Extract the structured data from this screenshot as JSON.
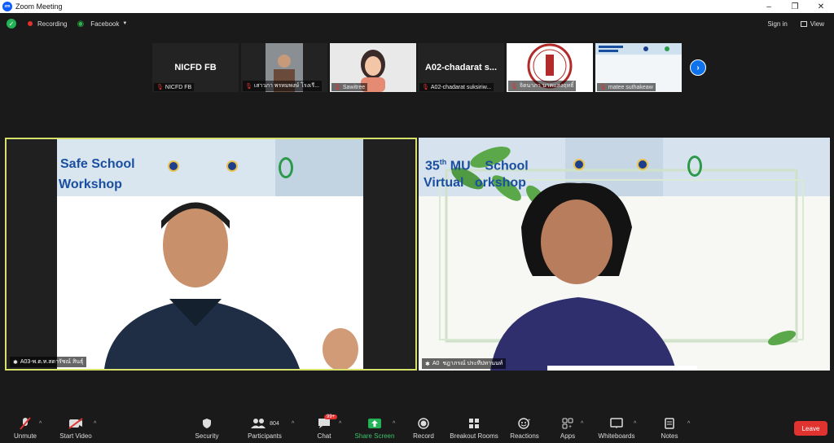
{
  "window": {
    "title": "Zoom Meeting",
    "app_logo": "zoom"
  },
  "topbar": {
    "recording_label": "Recording",
    "stream_label": "Facebook",
    "signin_label": "Sign in",
    "view_label": "View"
  },
  "thumbnails": [
    {
      "big_name": "NICFD FB",
      "caption": "NICFD FB"
    },
    {
      "big_name": "",
      "caption": "เสาวภา พรหมพงษ์ โรงเรี..."
    },
    {
      "big_name": "",
      "caption": "Sawitree"
    },
    {
      "big_name": "A02-chadarat s...",
      "caption": "A02-chadarat suksiriw..."
    },
    {
      "big_name": "",
      "caption": "จิตนาภา นาคแสงฤทธิ์"
    },
    {
      "big_name": "",
      "caption": "matee suthakeaw"
    }
  ],
  "tiles": {
    "left": {
      "banner_line1": "Safe School",
      "banner_line2": "Workshop",
      "caption": "A03-พ.ต.ท.สดารัชณ์ สินธุ์"
    },
    "right": {
      "banner_line1": "35",
      "banner_sup": "th",
      "banner_line1_rest": "MU    School",
      "banner_line2": "Virtual   orkshop",
      "caption": "A0  ชฎาภรณ์ ประทีปทานนท์"
    }
  },
  "toolbar": {
    "unmute": "Unmute",
    "start_video": "Start Video",
    "security": "Security",
    "participants": "Participants",
    "participants_count": "804",
    "chat": "Chat",
    "chat_badge": "99+",
    "share_screen": "Share Screen",
    "record": "Record",
    "breakout_rooms": "Breakout Rooms",
    "reactions": "Reactions",
    "apps": "Apps",
    "whiteboards": "Whiteboards",
    "notes": "Notes",
    "leave": "Leave"
  },
  "colors": {
    "accent_blue": "#0e72ed",
    "leave_red": "#e0322f",
    "share_green": "#23b357",
    "active_border": "#d6e06a"
  }
}
